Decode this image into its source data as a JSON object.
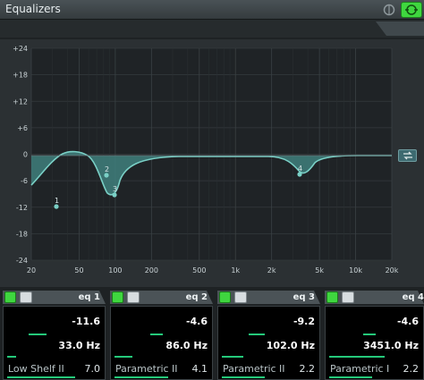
{
  "window": {
    "title": "Equalizers"
  },
  "graph": {
    "y_ticks": [
      "+24",
      "+18",
      "+12",
      "+6",
      "0",
      "-6",
      "-12",
      "-18",
      "-24"
    ],
    "x_ticks": [
      "20",
      "50",
      "100",
      "200",
      "500",
      "1k",
      "2k",
      "5k",
      "10k",
      "20k"
    ],
    "points": [
      "1",
      "2",
      "3",
      "4"
    ]
  },
  "bands": [
    {
      "name": "eq 1",
      "gain": "-11.6",
      "freq": "33.0 Hz",
      "type": "Low Shelf II",
      "q": "7.0"
    },
    {
      "name": "eq 2",
      "gain": "-4.6",
      "freq": "86.0 Hz",
      "type": "Parametric II",
      "q": "4.1"
    },
    {
      "name": "eq 3",
      "gain": "-9.2",
      "freq": "102.0 Hz",
      "type": "Parametric II",
      "q": "2.2"
    },
    {
      "name": "eq 4",
      "gain": "-4.6",
      "freq": "3451.0 Hz",
      "type": "Parametric I",
      "q": "2.2"
    }
  ],
  "colors": {
    "accent": "#3fd63f",
    "curve": "#5fb9b0",
    "fill": "#3f7f7c",
    "value_bar": "#25c97a"
  },
  "icons": {
    "power": "power-icon",
    "type": "filter-type-icon",
    "link": "link-icon",
    "io": "io-icon",
    "active": "active-icon"
  }
}
